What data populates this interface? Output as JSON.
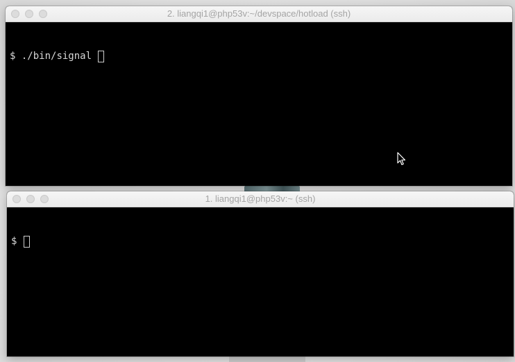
{
  "windows": [
    {
      "title": "2. liangqi1@php53v:~/devspace/hotload (ssh)",
      "prompt": "$",
      "command": " ./bin/signal "
    },
    {
      "title": "1. liangqi1@php53v:~ (ssh)",
      "prompt": "$",
      "command": " "
    }
  ],
  "colors": {
    "terminal_bg": "#000000",
    "terminal_text": "#d8d8d8",
    "titlebar_bg": "#ececec",
    "title_text": "#a4a4a4"
  },
  "icons": {
    "traffic_lights": [
      "close-button",
      "minimize-button",
      "zoom-button"
    ],
    "pointer": "mouse-pointer-icon"
  }
}
